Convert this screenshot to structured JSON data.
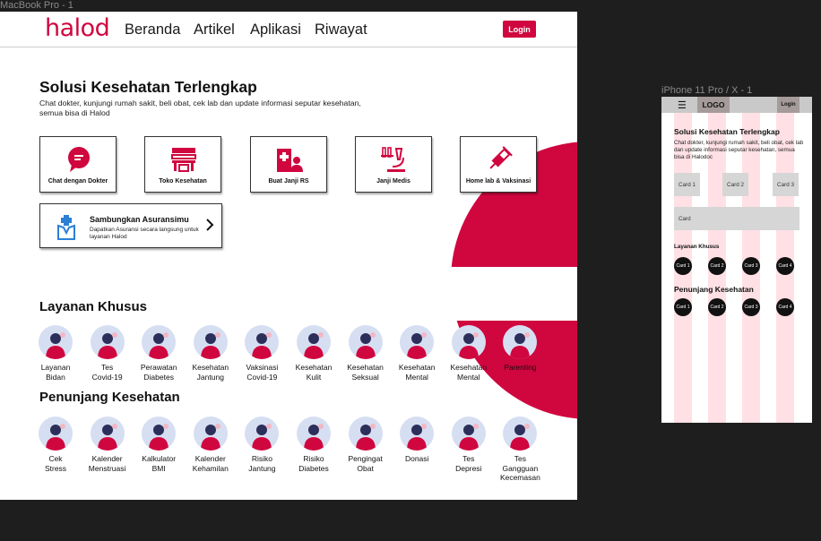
{
  "canvas": {
    "desktop_label": "MacBook Pro - 1",
    "mobile_label": "iPhone 11 Pro / X - 1"
  },
  "colors": {
    "brand": "#d0063f",
    "circle_bg": "#d6def2"
  },
  "desktop": {
    "logo": "halod",
    "nav": [
      "Beranda",
      "Artikel",
      "Aplikasi",
      "Riwayat"
    ],
    "login": "Login",
    "hero": {
      "title": "Solusi Kesehatan Terlengkap",
      "description": "Chat dokter, kunjungi rumah sakit, beli obat, cek lab dan update informasi seputar kesehatan, semua bisa di Halod"
    },
    "services": [
      {
        "label": "Chat dengan Dokter",
        "icon": "chat-bubble-icon"
      },
      {
        "label": "Toko Kesehatan",
        "icon": "store-icon"
      },
      {
        "label": "Buat Janji RS",
        "icon": "hospital-icon"
      },
      {
        "label": "Janji Medis",
        "icon": "microscope-icon"
      },
      {
        "label": "Home lab & Vaksinasi",
        "icon": "syringe-icon"
      }
    ],
    "insurance": {
      "title": "Sambungkan Asuransimu",
      "subtitle": "Dapatkan Asuransi secara langsung untuk layanan Halod",
      "icon": "insurance-icon"
    },
    "layanan": {
      "title": "Layanan Khusus",
      "items": [
        {
          "l1": "Layanan",
          "l2": "Bidan",
          "l3": ""
        },
        {
          "l1": "Tes",
          "l2": "Covid-19",
          "l3": ""
        },
        {
          "l1": "Perawatan",
          "l2": "Diabetes",
          "l3": ""
        },
        {
          "l1": "Kesehatan",
          "l2": "Jantung",
          "l3": ""
        },
        {
          "l1": "Vaksinasi",
          "l2": "Covid-19",
          "l3": ""
        },
        {
          "l1": "Kesehatan",
          "l2": "Kulit",
          "l3": ""
        },
        {
          "l1": "Kesehatan",
          "l2": "Seksual",
          "l3": ""
        },
        {
          "l1": "Kesehatan",
          "l2": "Mental",
          "l3": ""
        },
        {
          "l1": "Kesehatan",
          "l2": "Mental",
          "l3": ""
        },
        {
          "l1": "Parenting",
          "l2": "",
          "l3": ""
        }
      ]
    },
    "penunjang": {
      "title": "Penunjang Kesehatan",
      "items": [
        {
          "l1": "Cek",
          "l2": "Stress",
          "l3": ""
        },
        {
          "l1": "Kalender",
          "l2": "Menstruasi",
          "l3": ""
        },
        {
          "l1": "Kalkulator",
          "l2": "BMI",
          "l3": ""
        },
        {
          "l1": "Kalender",
          "l2": "Kehamilan",
          "l3": ""
        },
        {
          "l1": "Risiko",
          "l2": "Jantung",
          "l3": ""
        },
        {
          "l1": "Risiko",
          "l2": "Diabetes",
          "l3": ""
        },
        {
          "l1": "Pengingat",
          "l2": "Obat",
          "l3": ""
        },
        {
          "l1": "Donasi",
          "l2": "",
          "l3": ""
        },
        {
          "l1": "Tes",
          "l2": "Depresi",
          "l3": ""
        },
        {
          "l1": "Tes",
          "l2": "Gangguan",
          "l3": "Kecemasan"
        }
      ]
    }
  },
  "mobile": {
    "menu_icon": "hamburger-icon",
    "logo": "LOGO",
    "login": "Login",
    "title": "Solusi Kesehatan Terlengkap",
    "description": "Chat dokter, kunjungi rumah sakit, beli obat, cek lab dan update informasi seputar kesehatan, semua bisa di Halodoc",
    "cards": [
      "Card 1",
      "Card 2",
      "Card 3"
    ],
    "wide_card": "Card",
    "layanan_title": "Layanan Khusus",
    "layanan_dots": [
      "Card 1",
      "Card 2",
      "Card 3",
      "Card 4"
    ],
    "penunjang_title": "Penunjang Kesehatan",
    "penunjang_dots": [
      "Card 1",
      "Card 2",
      "Card 3",
      "Card 4"
    ]
  }
}
